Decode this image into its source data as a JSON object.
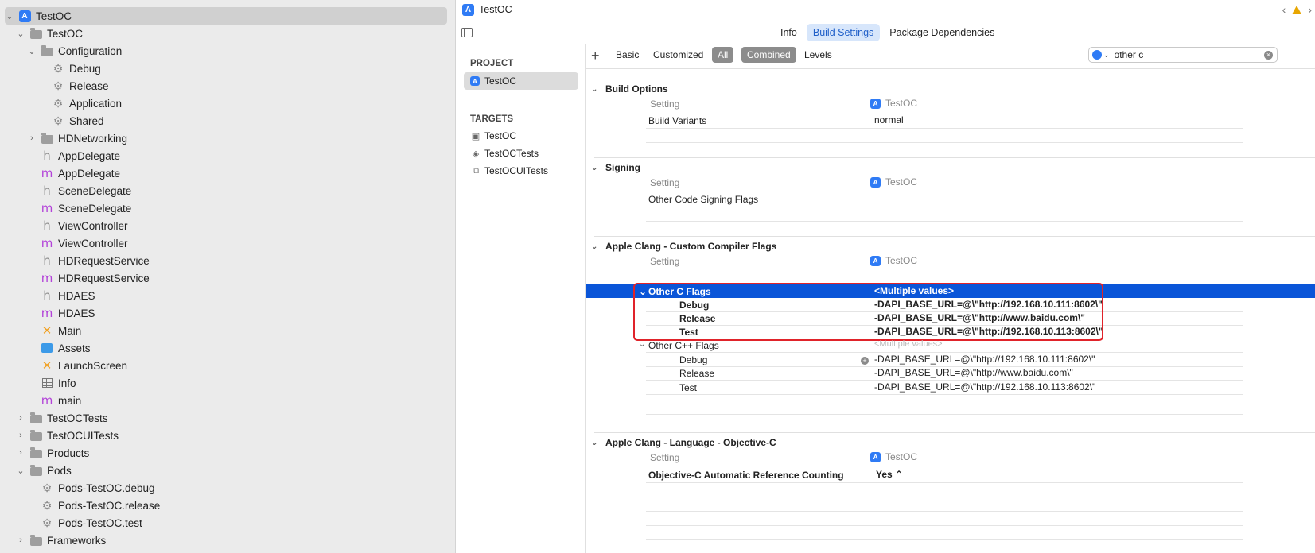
{
  "navigator": {
    "items": [
      {
        "label": "TestOC",
        "kind": "project",
        "disclosure": "open"
      },
      {
        "label": "TestOC",
        "kind": "folder",
        "disclosure": "open"
      },
      {
        "label": "Configuration",
        "kind": "folder",
        "disclosure": "open"
      },
      {
        "label": "Debug",
        "kind": "config"
      },
      {
        "label": "Release",
        "kind": "config"
      },
      {
        "label": "Application",
        "kind": "config"
      },
      {
        "label": "Shared",
        "kind": "config"
      },
      {
        "label": "HDNetworking",
        "kind": "folder",
        "disclosure": "closed"
      },
      {
        "label": "AppDelegate",
        "kind": "h"
      },
      {
        "label": "AppDelegate",
        "kind": "m"
      },
      {
        "label": "SceneDelegate",
        "kind": "h"
      },
      {
        "label": "SceneDelegate",
        "kind": "m"
      },
      {
        "label": "ViewController",
        "kind": "h"
      },
      {
        "label": "ViewController",
        "kind": "m"
      },
      {
        "label": "HDRequestService",
        "kind": "h"
      },
      {
        "label": "HDRequestService",
        "kind": "m"
      },
      {
        "label": "HDAES",
        "kind": "h"
      },
      {
        "label": "HDAES",
        "kind": "m"
      },
      {
        "label": "Main",
        "kind": "xib"
      },
      {
        "label": "Assets",
        "kind": "assets"
      },
      {
        "label": "LaunchScreen",
        "kind": "xib"
      },
      {
        "label": "Info",
        "kind": "plist"
      },
      {
        "label": "main",
        "kind": "m"
      },
      {
        "label": "TestOCTests",
        "kind": "folder",
        "disclosure": "closed"
      },
      {
        "label": "TestOCUITests",
        "kind": "folder",
        "disclosure": "closed"
      },
      {
        "label": "Products",
        "kind": "folder",
        "disclosure": "closed"
      },
      {
        "label": "Pods",
        "kind": "folder",
        "disclosure": "open"
      },
      {
        "label": "Pods-TestOC.debug",
        "kind": "config"
      },
      {
        "label": "Pods-TestOC.release",
        "kind": "config"
      },
      {
        "label": "Pods-TestOC.test",
        "kind": "config"
      },
      {
        "label": "Frameworks",
        "kind": "folder",
        "disclosure": "closed"
      }
    ]
  },
  "titlebar": {
    "title": "TestOC"
  },
  "tabs": {
    "info": "Info",
    "build_settings": "Build Settings",
    "package_dependencies": "Package Dependencies"
  },
  "targets_panel": {
    "project_header": "PROJECT",
    "project_item": "TestOC",
    "targets_header": "TARGETS",
    "targets": [
      "TestOC",
      "TestOCTests",
      "TestOCUITests"
    ]
  },
  "filterbar": {
    "basic": "Basic",
    "customized": "Customized",
    "all": "All",
    "combined": "Combined",
    "levels": "Levels",
    "search_value": "other c"
  },
  "settings": {
    "setting_col": "Setting",
    "target_col": "TestOC",
    "build_options": {
      "title": "Build Options",
      "row_label": "Build Variants",
      "row_value": "normal"
    },
    "signing": {
      "title": "Signing",
      "row_label": "Other Code Signing Flags"
    },
    "compiler_flags": {
      "title": "Apple Clang - Custom Compiler Flags",
      "other_c": {
        "label": "Other C Flags",
        "value": "<Multiple values>",
        "rows": [
          {
            "config": "Debug",
            "value": "-DAPI_BASE_URL=@\\\"http://192.168.10.111:8602\\\""
          },
          {
            "config": "Release",
            "value": "-DAPI_BASE_URL=@\\\"http://www.baidu.com\\\""
          },
          {
            "config": "Test",
            "value": "-DAPI_BASE_URL=@\\\"http://192.168.10.113:8602\\\""
          }
        ]
      },
      "other_cpp": {
        "label": "Other C++ Flags",
        "value": "<Multiple values>",
        "rows": [
          {
            "config": "Debug",
            "value": "-DAPI_BASE_URL=@\\\"http://192.168.10.111:8602\\\""
          },
          {
            "config": "Release",
            "value": "-DAPI_BASE_URL=@\\\"http://www.baidu.com\\\""
          },
          {
            "config": "Test",
            "value": "-DAPI_BASE_URL=@\\\"http://192.168.10.113:8602\\\""
          }
        ]
      }
    },
    "language_objc": {
      "title": "Apple Clang - Language - Objective-C",
      "row_label": "Objective-C Automatic Reference Counting",
      "row_value": "Yes ⌃"
    }
  },
  "colors": {
    "accent": "#2f7bf5",
    "selection": "#0a55d8",
    "highlight_box": "#e0232a",
    "header_m": "#b343d9"
  }
}
